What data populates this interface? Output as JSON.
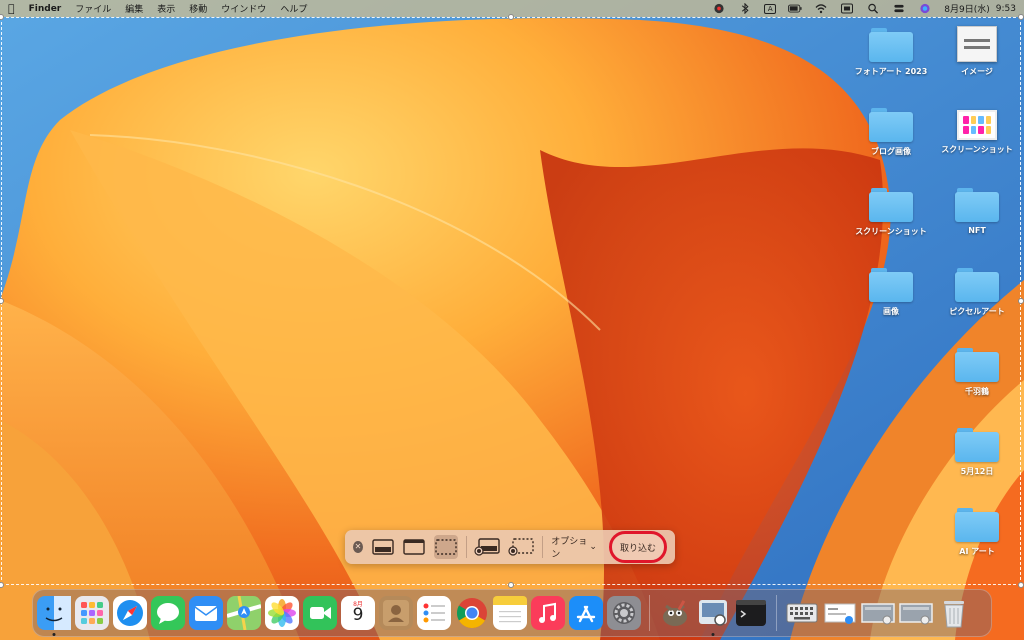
{
  "menubar": {
    "app_name": "Finder",
    "menus": [
      "ファイル",
      "編集",
      "表示",
      "移動",
      "ウインドウ",
      "ヘルプ"
    ],
    "input_indicator": "A",
    "date": "8月9日(水)",
    "time": "9:53"
  },
  "desktop_icons": [
    {
      "label": "フォトアート 2023",
      "kind": "folder"
    },
    {
      "label": "イメージ",
      "kind": "document-thumbnail"
    },
    {
      "label": "ブログ画像",
      "kind": "folder"
    },
    {
      "label": "スクリーンショット",
      "kind": "image-thumbnail"
    },
    {
      "label": "スクリーンショット",
      "kind": "folder"
    },
    {
      "label": "NFT",
      "kind": "folder"
    },
    {
      "label": "画像",
      "kind": "folder"
    },
    {
      "label": "ピクセルアート",
      "kind": "folder"
    },
    {
      "label": "千羽鶴",
      "kind": "folder"
    },
    {
      "label": "5月12日",
      "kind": "folder"
    },
    {
      "label": "AI アート",
      "kind": "folder"
    }
  ],
  "screenshot_toolbar": {
    "options_label": "オプション",
    "capture_label": "取り込む",
    "close_icon": "close-icon"
  },
  "dock": {
    "calendar_day": "9",
    "calendar_month": "8月"
  },
  "colors": {
    "capture_highlight": "#e0162b",
    "folder_blue": "#5ab6ee"
  }
}
